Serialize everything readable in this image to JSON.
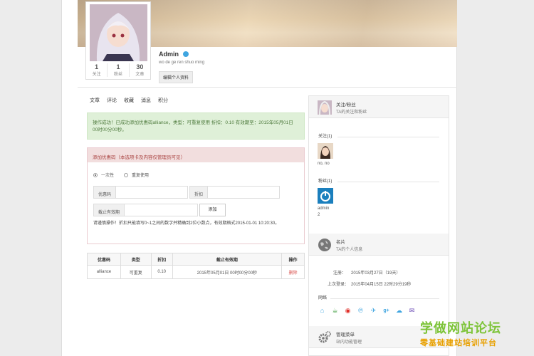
{
  "profile": {
    "username": "Admin",
    "bio": "wo de ge ren shuo ming",
    "edit_label": "编辑个人资料",
    "stats": [
      {
        "num": "1",
        "label": "关注"
      },
      {
        "num": "1",
        "label": "粉丝"
      },
      {
        "num": "30",
        "label": "文章"
      }
    ]
  },
  "tabs": [
    "文章",
    "评论",
    "收藏",
    "消息",
    "积分"
  ],
  "alert": {
    "text": "操作成功！已成功添加优惠码alliance，类型：可重复使用 折扣：0.10 有效期至：2015年05月01日 00时00分00秒。"
  },
  "coupon_panel": {
    "title": "添加优惠码（本选项卡及内容仅管理员可见）",
    "radio_once": "一次性",
    "radio_repeat": "重复使用",
    "code_label": "优惠码",
    "discount_label": "折扣",
    "expire_label": "截止有效期",
    "add_label": "添加",
    "hint": "请谨慎操作！折扣只能填写0~1之间的数字并精确到2位小数点，有效期格式2015-01-01 10:20:30。"
  },
  "table": {
    "headers": [
      "优惠码",
      "类型",
      "折扣",
      "截止有效期",
      "操作"
    ],
    "rows": [
      [
        "alliance",
        "可重复",
        "0.10",
        "2015年05月01日 00时00分00秒",
        "删除"
      ]
    ]
  },
  "sidebar": {
    "follow_title": "关注/粉丝",
    "follow_sub": "TA的关注和粉丝",
    "following_label": "关注(1)",
    "following_name": "no, no",
    "fans_label": "粉丝(1)",
    "fans_name": "admin",
    "fans_count": "2",
    "card_title": "名片",
    "card_sub": "TA的个人信息",
    "register_label": "注册：",
    "register_value": "2015年03月27日（19天）",
    "login_label": "上次登录：",
    "login_value": "2015年04月15日 22时29分19秒",
    "network_label": "网络",
    "admin_title": "管理菜单",
    "admin_sub": "站内功能管理"
  },
  "social_icons": [
    "home-icon",
    "cup-icon",
    "weibo-icon",
    "pinterest-icon",
    "twitter-icon",
    "googleplus-icon",
    "wechat-icon",
    "mail-icon"
  ],
  "watermark": {
    "line1": "学做网站论坛",
    "line2": "零基础建站培训平台"
  },
  "colors": {
    "success_bg": "#dff0d8",
    "danger_bg": "#f2dede",
    "accent": "#3fa5e0",
    "delete": "#d9534f"
  }
}
